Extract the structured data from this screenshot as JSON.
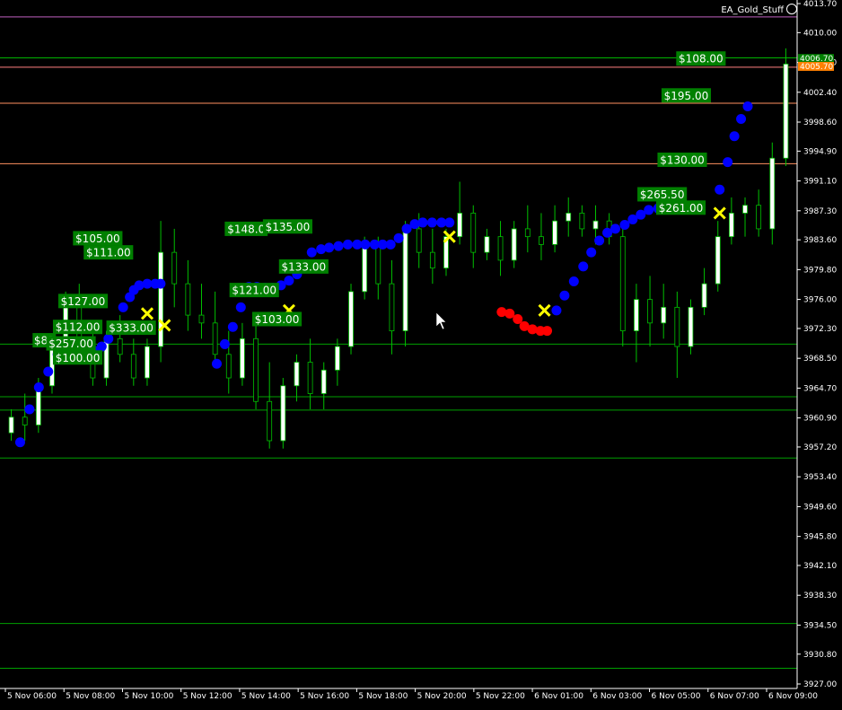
{
  "indicator": {
    "name": "EA_Gold_Stuff"
  },
  "colors": {
    "background": "#000000",
    "candle_bull": "#ffffff",
    "candle_edge": "#00c000",
    "trend_up": "#0000ff",
    "trend_down": "#ff0000",
    "cross_marker": "#ffff00",
    "label_bg": "#008000",
    "bid_tag": "#008000",
    "ask_tag": "#ff8000",
    "level_line": "#00a000"
  },
  "chart_data": {
    "type": "candlestick",
    "symbol_indicator": "EA_Gold_Stuff",
    "ylim": [
      3927.0,
      4013.7
    ],
    "y_ticks": [
      "4013.70",
      "4010.00",
      "4006.20",
      "4002.40",
      "3998.60",
      "3994.90",
      "3991.10",
      "3987.30",
      "3983.60",
      "3979.80",
      "3976.00",
      "3972.30",
      "3968.50",
      "3964.70",
      "3960.90",
      "3957.20",
      "3953.40",
      "3949.60",
      "3945.80",
      "3942.10",
      "3938.30",
      "3934.50",
      "3930.80",
      "3927.00"
    ],
    "x_ticks": [
      "5 Nov 06:00",
      "5 Nov 08:00",
      "5 Nov 10:00",
      "5 Nov 12:00",
      "5 Nov 14:00",
      "5 Nov 16:00",
      "5 Nov 18:00",
      "5 Nov 20:00",
      "5 Nov 22:00",
      "6 Nov 01:00",
      "6 Nov 03:00",
      "6 Nov 05:00",
      "6 Nov 07:00",
      "6 Nov 09:00"
    ],
    "current_bid": "4006.70",
    "current_ask": "4005.70",
    "horizontal_levels": [
      {
        "price": 4012.0,
        "color": "#c060c0"
      },
      {
        "price": 4006.8,
        "color": "#00c000"
      },
      {
        "price": 4005.6,
        "color": "#ff8080"
      },
      {
        "price": 4001.0,
        "color": "#ff9060"
      },
      {
        "price": 3993.3,
        "color": "#ff9060"
      },
      {
        "price": 3970.3,
        "color": "#00a000"
      },
      {
        "price": 3963.6,
        "color": "#00a000"
      },
      {
        "price": 3961.9,
        "color": "#00a000"
      },
      {
        "price": 3955.8,
        "color": "#00a000"
      },
      {
        "price": 3934.7,
        "color": "#00a000"
      },
      {
        "price": 3929.0,
        "color": "#00a000"
      }
    ],
    "trend_points_up": [
      [
        0.5,
        3957.8
      ],
      [
        1.2,
        3962.0
      ],
      [
        1.9,
        3964.8
      ],
      [
        2.6,
        3966.8
      ],
      [
        3.3,
        3969.0
      ],
      [
        4.0,
        3969.0
      ],
      [
        4.6,
        3969.0
      ],
      [
        5.3,
        3969.0
      ],
      [
        6.0,
        3969.5
      ],
      [
        6.6,
        3970.0
      ],
      [
        7.1,
        3971.0
      ],
      [
        7.6,
        3972.5
      ],
      [
        8.2,
        3975.0
      ],
      [
        8.7,
        3976.3
      ],
      [
        9.0,
        3977.2
      ],
      [
        9.4,
        3977.8
      ],
      [
        10.0,
        3978.0
      ],
      [
        10.6,
        3978.0
      ],
      [
        11.0,
        3978.0
      ],
      [
        15.2,
        3967.8
      ],
      [
        15.8,
        3970.3
      ],
      [
        16.4,
        3972.5
      ],
      [
        17.0,
        3975.0
      ],
      [
        17.6,
        3977.6
      ],
      [
        18.2,
        3977.6
      ],
      [
        18.8,
        3977.5
      ],
      [
        19.4,
        3977.5
      ],
      [
        20.0,
        3977.8
      ],
      [
        20.6,
        3978.4
      ],
      [
        21.2,
        3979.2
      ],
      [
        21.8,
        3980.5
      ],
      [
        22.3,
        3982.0
      ],
      [
        23.0,
        3982.4
      ],
      [
        23.6,
        3982.6
      ],
      [
        24.3,
        3982.8
      ],
      [
        25.0,
        3983.0
      ],
      [
        25.7,
        3983.0
      ],
      [
        26.3,
        3983.0
      ],
      [
        27.0,
        3983.0
      ],
      [
        27.6,
        3983.0
      ],
      [
        28.2,
        3983.0
      ],
      [
        28.8,
        3983.8
      ],
      [
        29.4,
        3985.0
      ],
      [
        30.0,
        3985.6
      ],
      [
        30.6,
        3985.8
      ],
      [
        31.3,
        3985.8
      ],
      [
        32.0,
        3985.8
      ],
      [
        32.6,
        3985.8
      ],
      [
        40.6,
        3974.6
      ],
      [
        41.2,
        3976.5
      ],
      [
        41.9,
        3978.3
      ],
      [
        42.6,
        3980.2
      ],
      [
        43.2,
        3982.0
      ],
      [
        43.8,
        3983.5
      ],
      [
        44.4,
        3984.5
      ],
      [
        45.0,
        3985.0
      ],
      [
        45.7,
        3985.5
      ],
      [
        46.3,
        3986.2
      ],
      [
        46.9,
        3986.8
      ],
      [
        47.5,
        3987.4
      ],
      [
        48.2,
        3987.6
      ],
      [
        48.9,
        3987.7
      ],
      [
        52.8,
        3990.0
      ],
      [
        53.4,
        3993.5
      ],
      [
        53.9,
        3996.8
      ],
      [
        54.4,
        3999.0
      ],
      [
        54.9,
        4000.6
      ]
    ],
    "trend_points_down": [
      [
        36.5,
        3974.4
      ],
      [
        37.1,
        3974.2
      ],
      [
        37.7,
        3973.5
      ],
      [
        38.2,
        3972.6
      ],
      [
        38.8,
        3972.2
      ],
      [
        39.4,
        3972.0
      ],
      [
        39.9,
        3972.0
      ]
    ],
    "cross_markers": [
      [
        10.0,
        3974.2
      ],
      [
        11.3,
        3972.7
      ],
      [
        20.6,
        3974.6
      ],
      [
        32.6,
        3984.0
      ],
      [
        39.7,
        3974.6
      ],
      [
        52.8,
        3987.0
      ]
    ],
    "trade_labels": [
      {
        "text": "$105.00",
        "x": 6.3,
        "y": 3983.8
      },
      {
        "text": "$111.00",
        "x": 7.1,
        "y": 3982.0
      },
      {
        "text": "$127.00",
        "x": 5.2,
        "y": 3975.8
      },
      {
        "text": "$112.00",
        "x": 4.8,
        "y": 3972.5
      },
      {
        "text": "$333.00",
        "x": 8.8,
        "y": 3972.4
      },
      {
        "text": "$82",
        "x": 2.3,
        "y": 3970.8
      },
      {
        "text": "$257.00",
        "x": 4.3,
        "y": 3970.4
      },
      {
        "text": "$100.00",
        "x": 4.8,
        "y": 3968.6
      },
      {
        "text": "$148.0",
        "x": 17.4,
        "y": 3985.0
      },
      {
        "text": "$135.00",
        "x": 20.5,
        "y": 3985.3
      },
      {
        "text": "$121.00",
        "x": 18.0,
        "y": 3977.2
      },
      {
        "text": "$133.00",
        "x": 21.7,
        "y": 3980.2
      },
      {
        "text": "$103.00",
        "x": 19.7,
        "y": 3973.5
      },
      {
        "text": "$108.00",
        "x": 51.4,
        "y": 4006.7
      },
      {
        "text": "$195.00",
        "x": 50.3,
        "y": 4002.0
      },
      {
        "text": "$130.00",
        "x": 50.0,
        "y": 3993.8
      },
      {
        "text": "$265.50",
        "x": 48.5,
        "y": 3989.4
      },
      {
        "text": "$261.00",
        "x": 49.9,
        "y": 3987.7
      }
    ],
    "candles": [
      [
        3959,
        3962,
        3958,
        3961
      ],
      [
        3961,
        3964,
        3958,
        3960
      ],
      [
        3960,
        3966,
        3959,
        3965
      ],
      [
        3965,
        3971,
        3964,
        3970
      ],
      [
        3970,
        3977,
        3969,
        3976
      ],
      [
        3976,
        3978,
        3969,
        3970
      ],
      [
        3970,
        3972,
        3965,
        3966
      ],
      [
        3966,
        3972,
        3965,
        3971
      ],
      [
        3971,
        3974,
        3968,
        3969
      ],
      [
        3969,
        3971,
        3965,
        3966
      ],
      [
        3966,
        3971,
        3965,
        3970
      ],
      [
        3970,
        3986,
        3968,
        3982
      ],
      [
        3982,
        3985,
        3975,
        3978
      ],
      [
        3978,
        3981,
        3972,
        3974
      ],
      [
        3974,
        3978,
        3971,
        3973
      ],
      [
        3973,
        3977,
        3968,
        3969
      ],
      [
        3969,
        3972,
        3964,
        3966
      ],
      [
        3966,
        3973,
        3965,
        3971
      ],
      [
        3971,
        3973,
        3962,
        3963
      ],
      [
        3963,
        3968,
        3957,
        3958
      ],
      [
        3958,
        3966,
        3957,
        3965
      ],
      [
        3965,
        3969,
        3963,
        3968
      ],
      [
        3968,
        3971,
        3962,
        3964
      ],
      [
        3964,
        3968,
        3962,
        3967
      ],
      [
        3967,
        3971,
        3965,
        3970
      ],
      [
        3970,
        3978,
        3969,
        3977
      ],
      [
        3977,
        3984,
        3976,
        3983
      ],
      [
        3983,
        3984,
        3976,
        3978
      ],
      [
        3978,
        3981,
        3969,
        3972
      ],
      [
        3972,
        3986,
        3970,
        3985
      ],
      [
        3985,
        3987,
        3980,
        3982
      ],
      [
        3982,
        3985,
        3978,
        3980
      ],
      [
        3980,
        3985,
        3979,
        3984
      ],
      [
        3984,
        3991,
        3983,
        3987
      ],
      [
        3987,
        3988,
        3980,
        3982
      ],
      [
        3982,
        3985,
        3981,
        3984
      ],
      [
        3984,
        3986,
        3979,
        3981
      ],
      [
        3981,
        3986,
        3980,
        3985
      ],
      [
        3985,
        3988,
        3982,
        3984
      ],
      [
        3984,
        3987,
        3981,
        3983
      ],
      [
        3983,
        3988,
        3982,
        3986
      ],
      [
        3986,
        3989,
        3984,
        3987
      ],
      [
        3987,
        3988,
        3984,
        3985
      ],
      [
        3985,
        3988,
        3983,
        3986
      ],
      [
        3986,
        3987,
        3983,
        3984
      ],
      [
        3984,
        3985,
        3970,
        3972
      ],
      [
        3972,
        3978,
        3968,
        3976
      ],
      [
        3976,
        3979,
        3970,
        3973
      ],
      [
        3973,
        3978,
        3971,
        3975
      ],
      [
        3975,
        3977,
        3966,
        3970
      ],
      [
        3970,
        3976,
        3969,
        3975
      ],
      [
        3975,
        3980,
        3974,
        3978
      ],
      [
        3978,
        3986,
        3977,
        3984
      ],
      [
        3984,
        3989,
        3983,
        3987
      ],
      [
        3987,
        3989,
        3984,
        3988
      ],
      [
        3988,
        3990,
        3984,
        3985
      ],
      [
        3985,
        3996,
        3983,
        3994
      ],
      [
        3994,
        4008,
        3993,
        4006
      ]
    ]
  }
}
